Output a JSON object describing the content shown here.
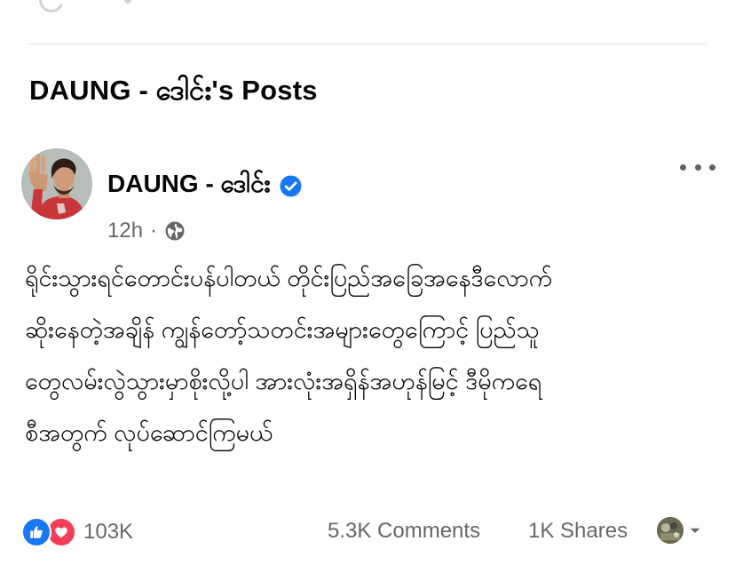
{
  "section": {
    "title": "DAUNG - ဒေါင်း's Posts"
  },
  "post": {
    "author": "DAUNG - ဒေါင်း",
    "verified": true,
    "time": "12h",
    "separator": "·",
    "audience_icon": "globe-icon",
    "more_icon": "more-horizontal-icon",
    "body_lines": [
      "ရိုင်းသွားရင်တောင်းပန်ပါတယ် တိုင်းပြည်အခြေအနေဒီလောက်",
      "ဆိုးနေတဲ့အချိန် ကျွန်တော့်သတင်းအများတွေကြောင့် ပြည်သူ",
      "တွေလမ်းလွဲသွားမှာစိုးလို့ပါ အားလုံးအရှိန်အဟုန်မြင့် ဒီမိုကရေ",
      "စီအတွက် လုပ်ဆောင်ကြမယ်"
    ]
  },
  "footer": {
    "reaction_icons": [
      "like-icon",
      "love-icon"
    ],
    "reaction_count": "103K",
    "comments": "5.3K Comments",
    "shares": "1K Shares",
    "page_selector_icon": "chevron-down-icon"
  },
  "colors": {
    "text_primary": "#050505",
    "text_secondary": "#65676b",
    "verified": "#1877f2",
    "like": "#1877f2",
    "love": "#f33e58",
    "divider": "#dcdee2"
  }
}
